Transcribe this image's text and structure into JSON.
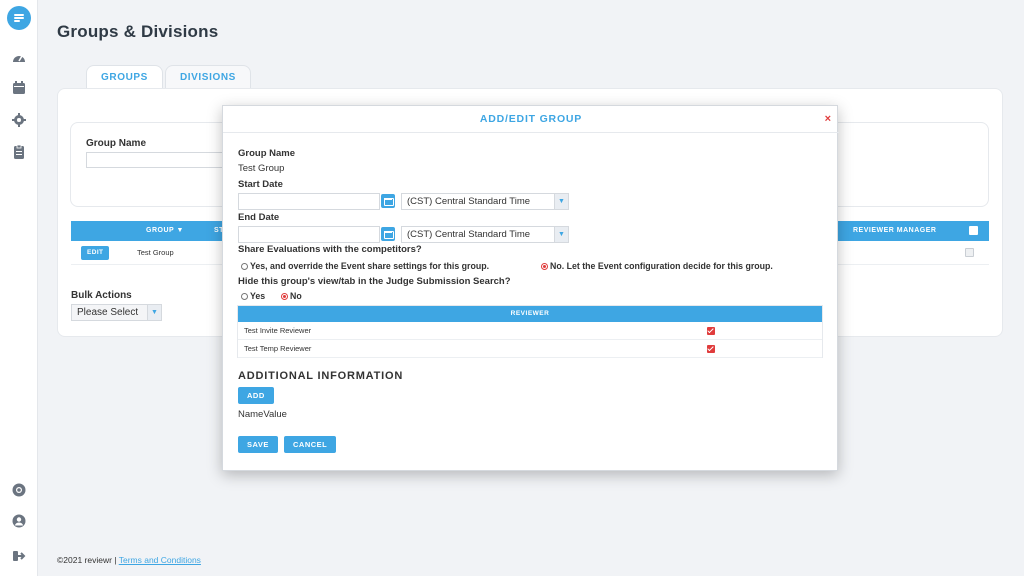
{
  "sidebar": {
    "icons": [
      "logo-icon",
      "dashboard-icon",
      "calendar-icon",
      "settings-icon",
      "clipboard-icon",
      "help-icon",
      "profile-icon",
      "logout-icon"
    ]
  },
  "header": {
    "title": "Groups & Divisions"
  },
  "tabs": [
    {
      "label": "GROUPS",
      "active": true
    },
    {
      "label": "DIVISIONS",
      "active": false
    }
  ],
  "filter": {
    "group_name_label": "Group Name",
    "group_name_value": ""
  },
  "table": {
    "headers": [
      "GROUP",
      "ST",
      "REVIEWER MANAGER"
    ],
    "rows": [
      {
        "edit_label": "EDIT",
        "group": "Test Group"
      }
    ]
  },
  "bulk": {
    "label": "Bulk Actions",
    "selected": "Please Select"
  },
  "footer": {
    "copyright": "©2021 reviewr |",
    "link": "Terms and Conditions"
  },
  "modal": {
    "title": "ADD/EDIT GROUP",
    "close": "×",
    "group_name_label": "Group Name",
    "group_name_value": "Test Group",
    "start_date_label": "Start Date",
    "start_date_value": "",
    "start_tz": "(CST) Central Standard Time",
    "end_date_label": "End Date",
    "end_date_value": "",
    "end_tz": "(CST) Central Standard Time",
    "share_question": "Share Evaluations with the competitors?",
    "share_yes": "Yes, and override the Event share settings for this group.",
    "share_no": "No. Let the Event configuration decide for this group.",
    "share_selected": "no",
    "hide_question": "Hide this group's view/tab in the Judge Submission Search?",
    "hide_yes": "Yes",
    "hide_no": "No",
    "hide_selected": "no",
    "reviewer_header": "REVIEWER",
    "reviewers": [
      {
        "name": "Test Invite Reviewer",
        "checked": true
      },
      {
        "name": "Test Temp Reviewer",
        "checked": true
      }
    ],
    "additional_title": "ADDITIONAL INFORMATION",
    "add_label": "ADD",
    "name_value_text": "NameValue",
    "save_label": "SAVE",
    "cancel_label": "CANCEL"
  },
  "colors": {
    "accent": "#3ea6e3",
    "danger": "#e03c3c",
    "background": "#f1f3f6"
  }
}
